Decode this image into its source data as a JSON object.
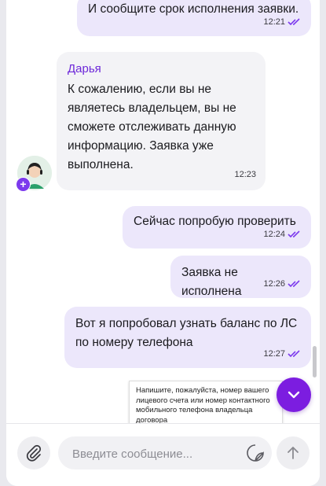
{
  "messages": [
    {
      "id": "m1",
      "text": "И сообщите срок исполнения заявки.",
      "time": "12:21",
      "direction": "out"
    },
    {
      "id": "m2",
      "sender": "Дарья",
      "text": "К сожалению, если вы не являетесь владельцем, вы не сможете отслеживать данную информацию. Заявка уже выполнена.",
      "time": "12:23",
      "direction": "in"
    },
    {
      "id": "m3",
      "text": "Сейчас попробую проверить",
      "time": "12:24",
      "direction": "out"
    },
    {
      "id": "m4",
      "text": "Заявка не исполнена",
      "time": "12:26",
      "direction": "out"
    },
    {
      "id": "m5",
      "text": "Вот я попробовал узнать баланс по ЛС по номеру телефона",
      "time": "12:27",
      "direction": "out"
    }
  ],
  "preview": {
    "text": "Напишите, пожалуйста, номер вашего лицевого счета или номер контактного мобильного телефона владельца договора"
  },
  "composer": {
    "placeholder": "Введите сообщение..."
  },
  "icons": {
    "attach": "paperclip-icon",
    "emoji": "sticker-icon",
    "send": "arrow-up-icon",
    "scroll": "chevron-down-icon",
    "read": "double-check-icon"
  },
  "colors": {
    "accent": "#7c1de0",
    "outgoing_bubble": "#ece7fb",
    "incoming_bubble": "#f3f3f6",
    "sender_name": "#6d28d9"
  }
}
